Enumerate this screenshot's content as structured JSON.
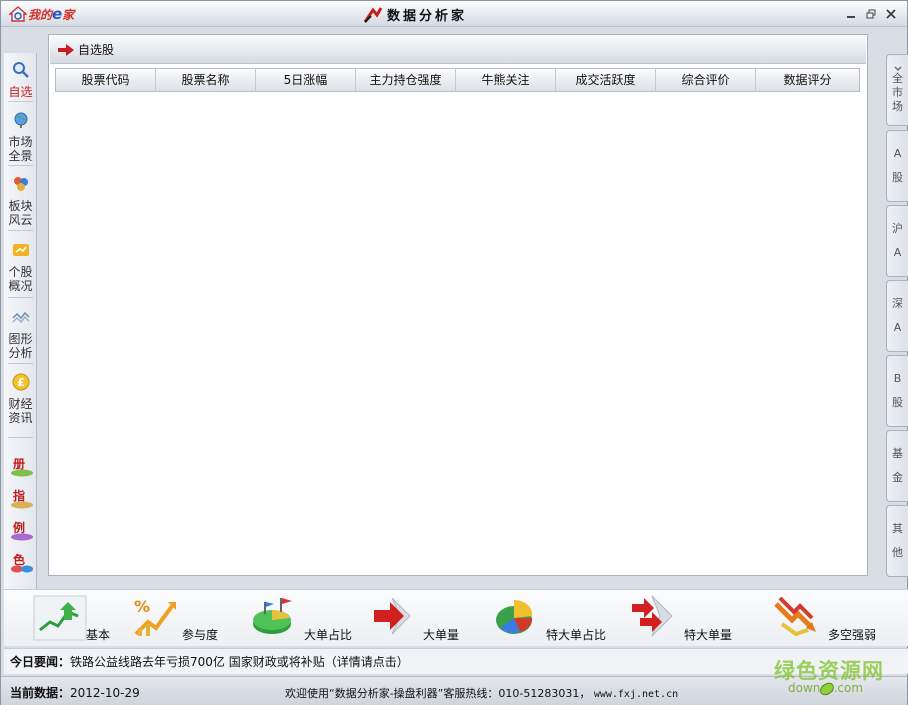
{
  "titlebar": {
    "logo_text_1": "我的",
    "logo_text_e": "e",
    "logo_text_2": "家",
    "app_title": "数据分析家",
    "minimize": "▭",
    "restore": "❐",
    "close": "✕"
  },
  "leftnav": {
    "items": [
      {
        "label_1": "自选",
        "label_2": "",
        "icon": "magnifier-icon",
        "active": true
      },
      {
        "label_1": "市场",
        "label_2": "全景",
        "icon": "globe-icon",
        "active": false
      },
      {
        "label_1": "板块",
        "label_2": "风云",
        "icon": "blocks-icon",
        "active": false
      },
      {
        "label_1": "个股",
        "label_2": "概况",
        "icon": "stock-card-icon",
        "active": false
      },
      {
        "label_1": "图形",
        "label_2": "分析",
        "icon": "wave-chart-icon",
        "active": false
      },
      {
        "label_1": "财经",
        "label_2": "资讯",
        "icon": "pound-coin-icon",
        "active": false
      }
    ],
    "small_items": [
      "册",
      "指",
      "例",
      "色"
    ]
  },
  "righttabs": [
    {
      "line_1": "全",
      "line_2": "市",
      "line_3": "场"
    },
    {
      "line_1": "A",
      "line_2": "股",
      "line_3": ""
    },
    {
      "line_1": "沪",
      "line_2": "A",
      "line_3": ""
    },
    {
      "line_1": "深",
      "line_2": "A",
      "line_3": ""
    },
    {
      "line_1": "B",
      "line_2": "股",
      "line_3": ""
    },
    {
      "line_1": "基",
      "line_2": "金",
      "line_3": ""
    },
    {
      "line_1": "其",
      "line_2": "他",
      "line_3": ""
    }
  ],
  "panel": {
    "title": "自选股",
    "columns": [
      "股票代码",
      "股票名称",
      "5日涨幅",
      "主力持仓强度",
      "牛熊关注",
      "成交活跃度",
      "综合评价",
      "数据评分"
    ],
    "rows": []
  },
  "toolbar": {
    "items": [
      {
        "label": "基本",
        "icon": "basic-chart-icon"
      },
      {
        "label": "参与度",
        "icon": "percent-arrow-icon"
      },
      {
        "label": "大单占比",
        "icon": "pie-flags-icon"
      },
      {
        "label": "大单量",
        "icon": "red-arrow-icon"
      },
      {
        "label": "特大单占比",
        "icon": "pie-chart-icon"
      },
      {
        "label": "特大单量",
        "icon": "double-arrow-icon"
      },
      {
        "label": "多空强弱",
        "icon": "bull-bear-arrows-icon"
      }
    ]
  },
  "news": {
    "prefix": "今日要闻：",
    "text": "铁路公益线路去年亏损700亿 国家财政或将补贴（详情请点击）"
  },
  "status": {
    "date_label": "当前数据：",
    "date_value": "2012-10-29",
    "welcome": "欢迎使用“数据分析家-操盘利器”客服热线：010-51283031，",
    "url": "www.fxj.net.cn"
  },
  "watermark": {
    "big": "绿色资源网",
    "small": "downcc.com"
  },
  "colors": {
    "accent_red": "#c81e1e",
    "frame": "#d9dde4",
    "watermark_green": "#7fc42a"
  }
}
